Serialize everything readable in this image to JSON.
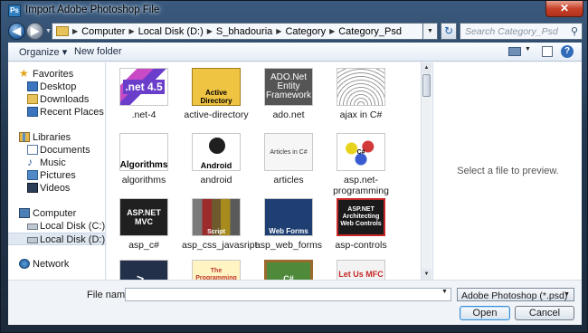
{
  "window": {
    "title": "Import Adobe Photoshop File",
    "app_icon": "Ps",
    "close_glyph": "✕"
  },
  "address": {
    "back_glyph": "◀",
    "forward_glyph": "▶",
    "breadcrumbs": [
      "Computer",
      "Local Disk (D:)",
      "S_bhadouria",
      "Category",
      "Category_Psd"
    ],
    "separator": "▶",
    "dropdown_glyph": "▼",
    "refresh_glyph": "↻",
    "search_placeholder": "Search Category_Psd",
    "search_glyph": "⚲"
  },
  "toolbar": {
    "organize_label": "Organize ▾",
    "new_folder_label": "New folder",
    "views_drop": "▼",
    "help_glyph": "?"
  },
  "nav": {
    "favorites": {
      "label": "Favorites",
      "items": [
        "Desktop",
        "Downloads",
        "Recent Places"
      ]
    },
    "libraries": {
      "label": "Libraries",
      "items": [
        "Documents",
        "Music",
        "Pictures",
        "Videos"
      ]
    },
    "computer": {
      "label": "Computer",
      "items": [
        "Local Disk (C:)",
        "Local Disk (D:)"
      ],
      "selected": "Local Disk (D:)"
    },
    "network": {
      "label": "Network"
    },
    "star_glyph": "★",
    "note_glyph": "♪"
  },
  "files": [
    {
      "name": ".net-4",
      "thumb_text": ".net 4.5"
    },
    {
      "name": "active-directory",
      "thumb_text": "Active Directory"
    },
    {
      "name": "ado.net",
      "thumb_text": "ADO.Net Entity Framework"
    },
    {
      "name": "ajax in C#",
      "thumb_text": ""
    },
    {
      "name": "algorithms",
      "thumb_text": "Algorithms"
    },
    {
      "name": "android",
      "thumb_text": "Android"
    },
    {
      "name": "articles",
      "thumb_text": "Articles in C#"
    },
    {
      "name": "asp.net-programming",
      "thumb_text": "C#"
    },
    {
      "name": "asp_c#",
      "thumb_text": "ASP.NET MVC"
    },
    {
      "name": "asp_css_javasript",
      "thumb_text": "Script"
    },
    {
      "name": "asp_web_forms",
      "thumb_text": "Web Forms"
    },
    {
      "name": "asp-controls",
      "thumb_text": "ASP.NET Architecting Web Controls"
    },
    {
      "name": "",
      "thumb_text": ">_"
    },
    {
      "name": "",
      "thumb_text": "The Programming Language C#"
    },
    {
      "name": "",
      "thumb_text": "C#"
    },
    {
      "name": "",
      "thumb_text": "Let Us MFC C++"
    }
  ],
  "scrollbar": {
    "up_glyph": "▲",
    "down_glyph": "▼"
  },
  "preview": {
    "text": "Select a file to preview."
  },
  "footer": {
    "filename_label": "File name:",
    "filename_value": "",
    "filename_drop": "▼",
    "filetype_value": "Adobe Photoshop (*.psd)",
    "filetype_drop": "▼",
    "open_label": "Open",
    "cancel_label": "Cancel"
  }
}
